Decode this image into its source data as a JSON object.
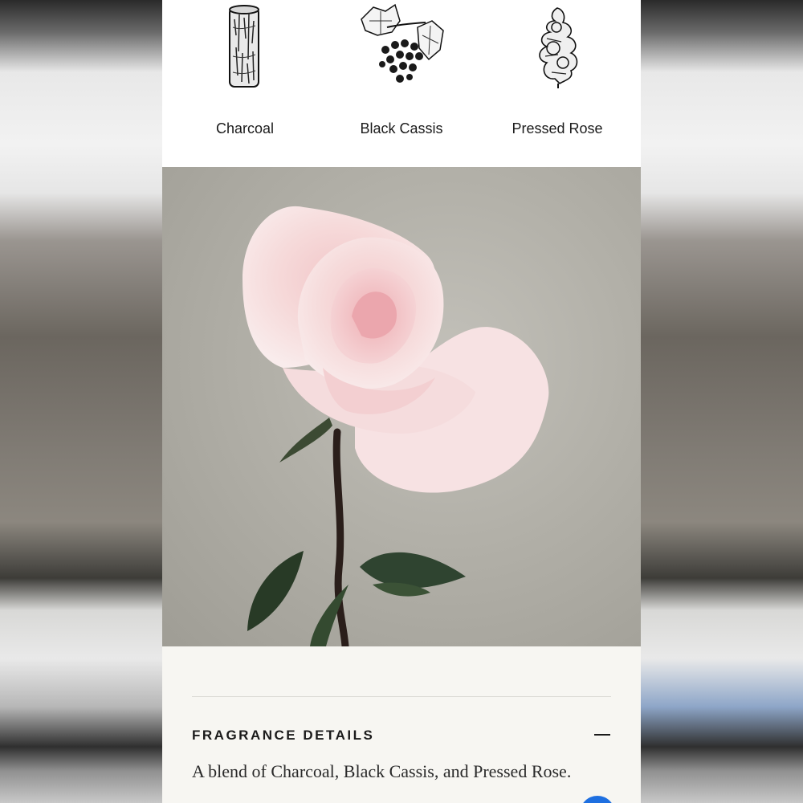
{
  "notes": [
    {
      "label": "Charcoal",
      "icon": "charcoal-stick-icon"
    },
    {
      "label": "Black Cassis",
      "icon": "black-cassis-berries-icon"
    },
    {
      "label": "Pressed Rose",
      "icon": "pressed-rose-icon"
    }
  ],
  "hero": {
    "subject": "pink-rose-photo"
  },
  "details": {
    "title": "FRAGRANCE DETAILS",
    "description": "A blend of Charcoal, Black Cassis, and Pressed Rose.",
    "toggle_icon": "minus-icon"
  },
  "colors": {
    "accent_chat": "#1e6fe0",
    "panel_bg": "#f7f6f2",
    "text_dark": "#1a1a1a"
  }
}
